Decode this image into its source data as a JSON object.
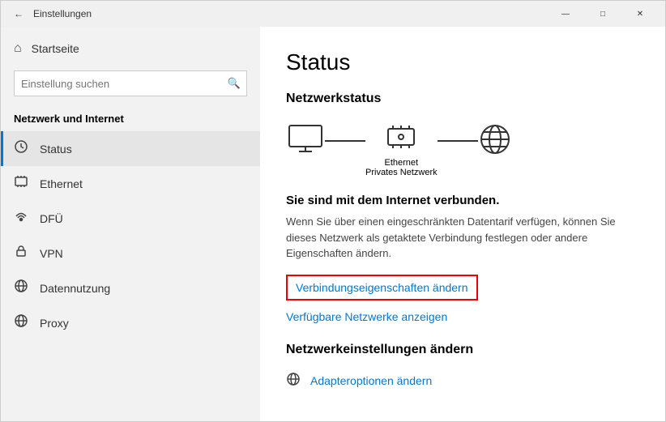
{
  "window": {
    "title": "Einstellungen",
    "controls": {
      "minimize": "—",
      "maximize": "□",
      "close": "✕"
    }
  },
  "sidebar": {
    "home_label": "Startseite",
    "search_placeholder": "Einstellung suchen",
    "section_title": "Netzwerk und Internet",
    "items": [
      {
        "id": "status",
        "label": "Status",
        "active": true
      },
      {
        "id": "ethernet",
        "label": "Ethernet",
        "active": false
      },
      {
        "id": "dfu",
        "label": "DFÜ",
        "active": false
      },
      {
        "id": "vpn",
        "label": "VPN",
        "active": false
      },
      {
        "id": "datennutzung",
        "label": "Datennutzung",
        "active": false
      },
      {
        "id": "proxy",
        "label": "Proxy",
        "active": false
      }
    ]
  },
  "main": {
    "page_title": "Status",
    "network_status_title": "Netzwerkstatus",
    "network_node_label1": "Ethernet",
    "network_node_label2": "Privates Netzwerk",
    "connected_text": "Sie sind mit dem Internet verbunden.",
    "desc_text": "Wenn Sie über einen eingeschränkten Datentarif verfügen, können Sie dieses Netzwerk als getaktete Verbindung festlegen oder andere Eigenschaften ändern.",
    "link_properties": "Verbindungseigenschaften ändern",
    "link_networks": "Verfügbare Netzwerke anzeigen",
    "change_section_title": "Netzwerkeinstellungen ändern",
    "adapter_label": "Adapteroptionen ändern"
  }
}
